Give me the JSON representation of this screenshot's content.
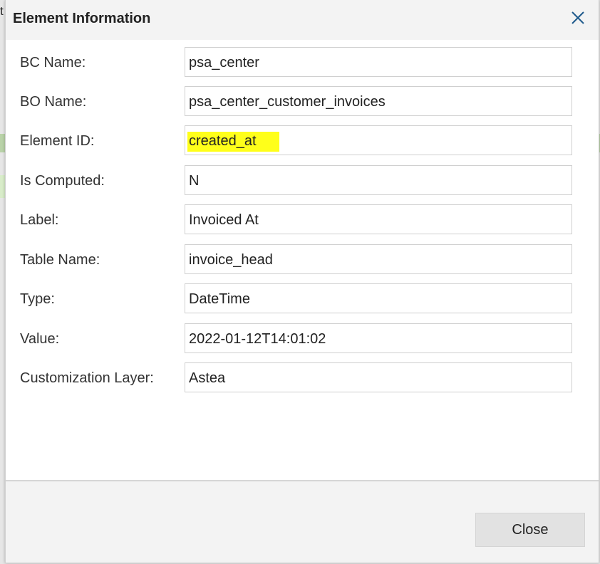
{
  "background": {
    "edge_char": "t"
  },
  "dialog": {
    "title": "Element Information",
    "close_icon": "close-x-icon",
    "accent_color": "#1f5a8c",
    "highlight_color": "#ffff1a",
    "fields": [
      {
        "label": "BC Name:",
        "value": "psa_center"
      },
      {
        "label": "BO Name:",
        "value": "psa_center_customer_invoices"
      },
      {
        "label": "Element ID:",
        "value": "created_at",
        "highlighted": true
      },
      {
        "label": "Is Computed:",
        "value": "N"
      },
      {
        "label": "Label:",
        "value": "Invoiced At"
      },
      {
        "label": "Table Name:",
        "value": "invoice_head"
      },
      {
        "label": "Type:",
        "value": "DateTime"
      },
      {
        "label": "Value:",
        "value": "2022-01-12T14:01:02"
      },
      {
        "label": "Customization Layer:",
        "value": "Astea"
      }
    ],
    "close_button_label": "Close"
  }
}
